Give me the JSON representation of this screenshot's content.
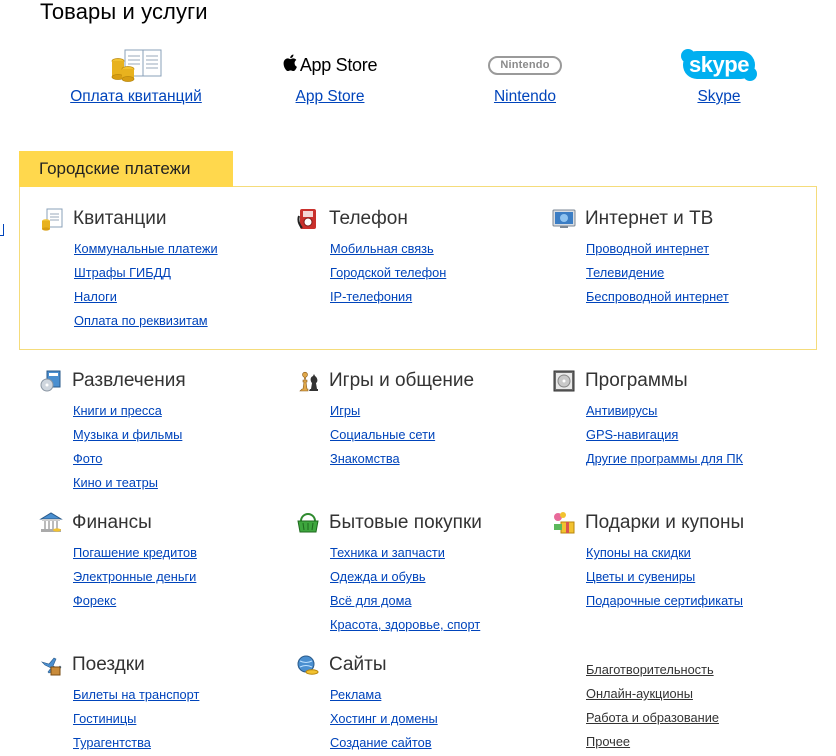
{
  "page": {
    "title": "Товары и услуги"
  },
  "vendors": [
    {
      "label": "Оплата квитанций",
      "logo": "receipt-coins-icon"
    },
    {
      "label": "App Store",
      "logo_text": "App Store",
      "logo": "apple-logo-icon"
    },
    {
      "label": "Nintendo",
      "logo_text": "Nintendo",
      "logo": "nintendo-logo"
    },
    {
      "label": "Skype",
      "logo_text": "skype",
      "logo": "skype-logo"
    }
  ],
  "city_payments": {
    "tab_label": "Городские платежи"
  },
  "categories": {
    "kvitancii": {
      "title": "Квитанции",
      "icon": "receipt-icon",
      "items": [
        "Коммунальные платежи",
        "Штрафы ГИБДД",
        "Налоги",
        "Оплата по реквизитам"
      ]
    },
    "telefon": {
      "title": "Телефон",
      "icon": "phone-icon",
      "items": [
        "Мобильная связь",
        "Городской телефон",
        "IP-телефония"
      ]
    },
    "internet": {
      "title": "Интернет и ТВ",
      "icon": "monitor-icon",
      "items": [
        "Проводной интернет",
        "Телевидение",
        "Беспроводной интернет"
      ]
    },
    "razvlecheniya": {
      "title": "Развлечения",
      "icon": "entertainment-icon",
      "items": [
        "Книги и пресса",
        "Музыка и фильмы",
        "Фото",
        "Кино и театры"
      ]
    },
    "igry": {
      "title": "Игры и общение",
      "icon": "chess-icon",
      "items": [
        "Игры",
        "Социальные сети",
        "Знакомства"
      ]
    },
    "programmy": {
      "title": "Программы",
      "icon": "software-icon",
      "items": [
        "Антивирусы",
        "GPS-навигация",
        "Другие программы для ПК"
      ]
    },
    "finansy": {
      "title": "Финансы",
      "icon": "bank-icon",
      "items": [
        "Погашение кредитов",
        "Электронные деньги",
        "Форекс"
      ]
    },
    "bytovye": {
      "title": "Бытовые покупки",
      "icon": "basket-icon",
      "items": [
        "Техника и запчасти",
        "Одежда и обувь",
        "Всё для дома",
        "Красота, здоровье, спорт"
      ]
    },
    "podarki": {
      "title": "Подарки и купоны",
      "icon": "gift-icon",
      "items": [
        "Купоны на скидки",
        "Цветы и сувениры",
        "Подарочные сертификаты"
      ]
    },
    "poezdki": {
      "title": "Поездки",
      "icon": "airplane-icon",
      "items": [
        "Билеты на транспорт",
        "Гостиницы",
        "Турагентства"
      ]
    },
    "saity": {
      "title": "Сайты",
      "icon": "globe-icon",
      "items": [
        "Реклама",
        "Хостинг и домены",
        "Создание сайтов"
      ]
    }
  },
  "misc_links": [
    "Благотворительность",
    "Онлайн-аукционы",
    "Работа и образование",
    "Прочее"
  ],
  "colors": {
    "link": "#0044bb",
    "tab_yellow": "#ffd84d",
    "box_border": "#f5dc7b",
    "text": "#333333"
  }
}
